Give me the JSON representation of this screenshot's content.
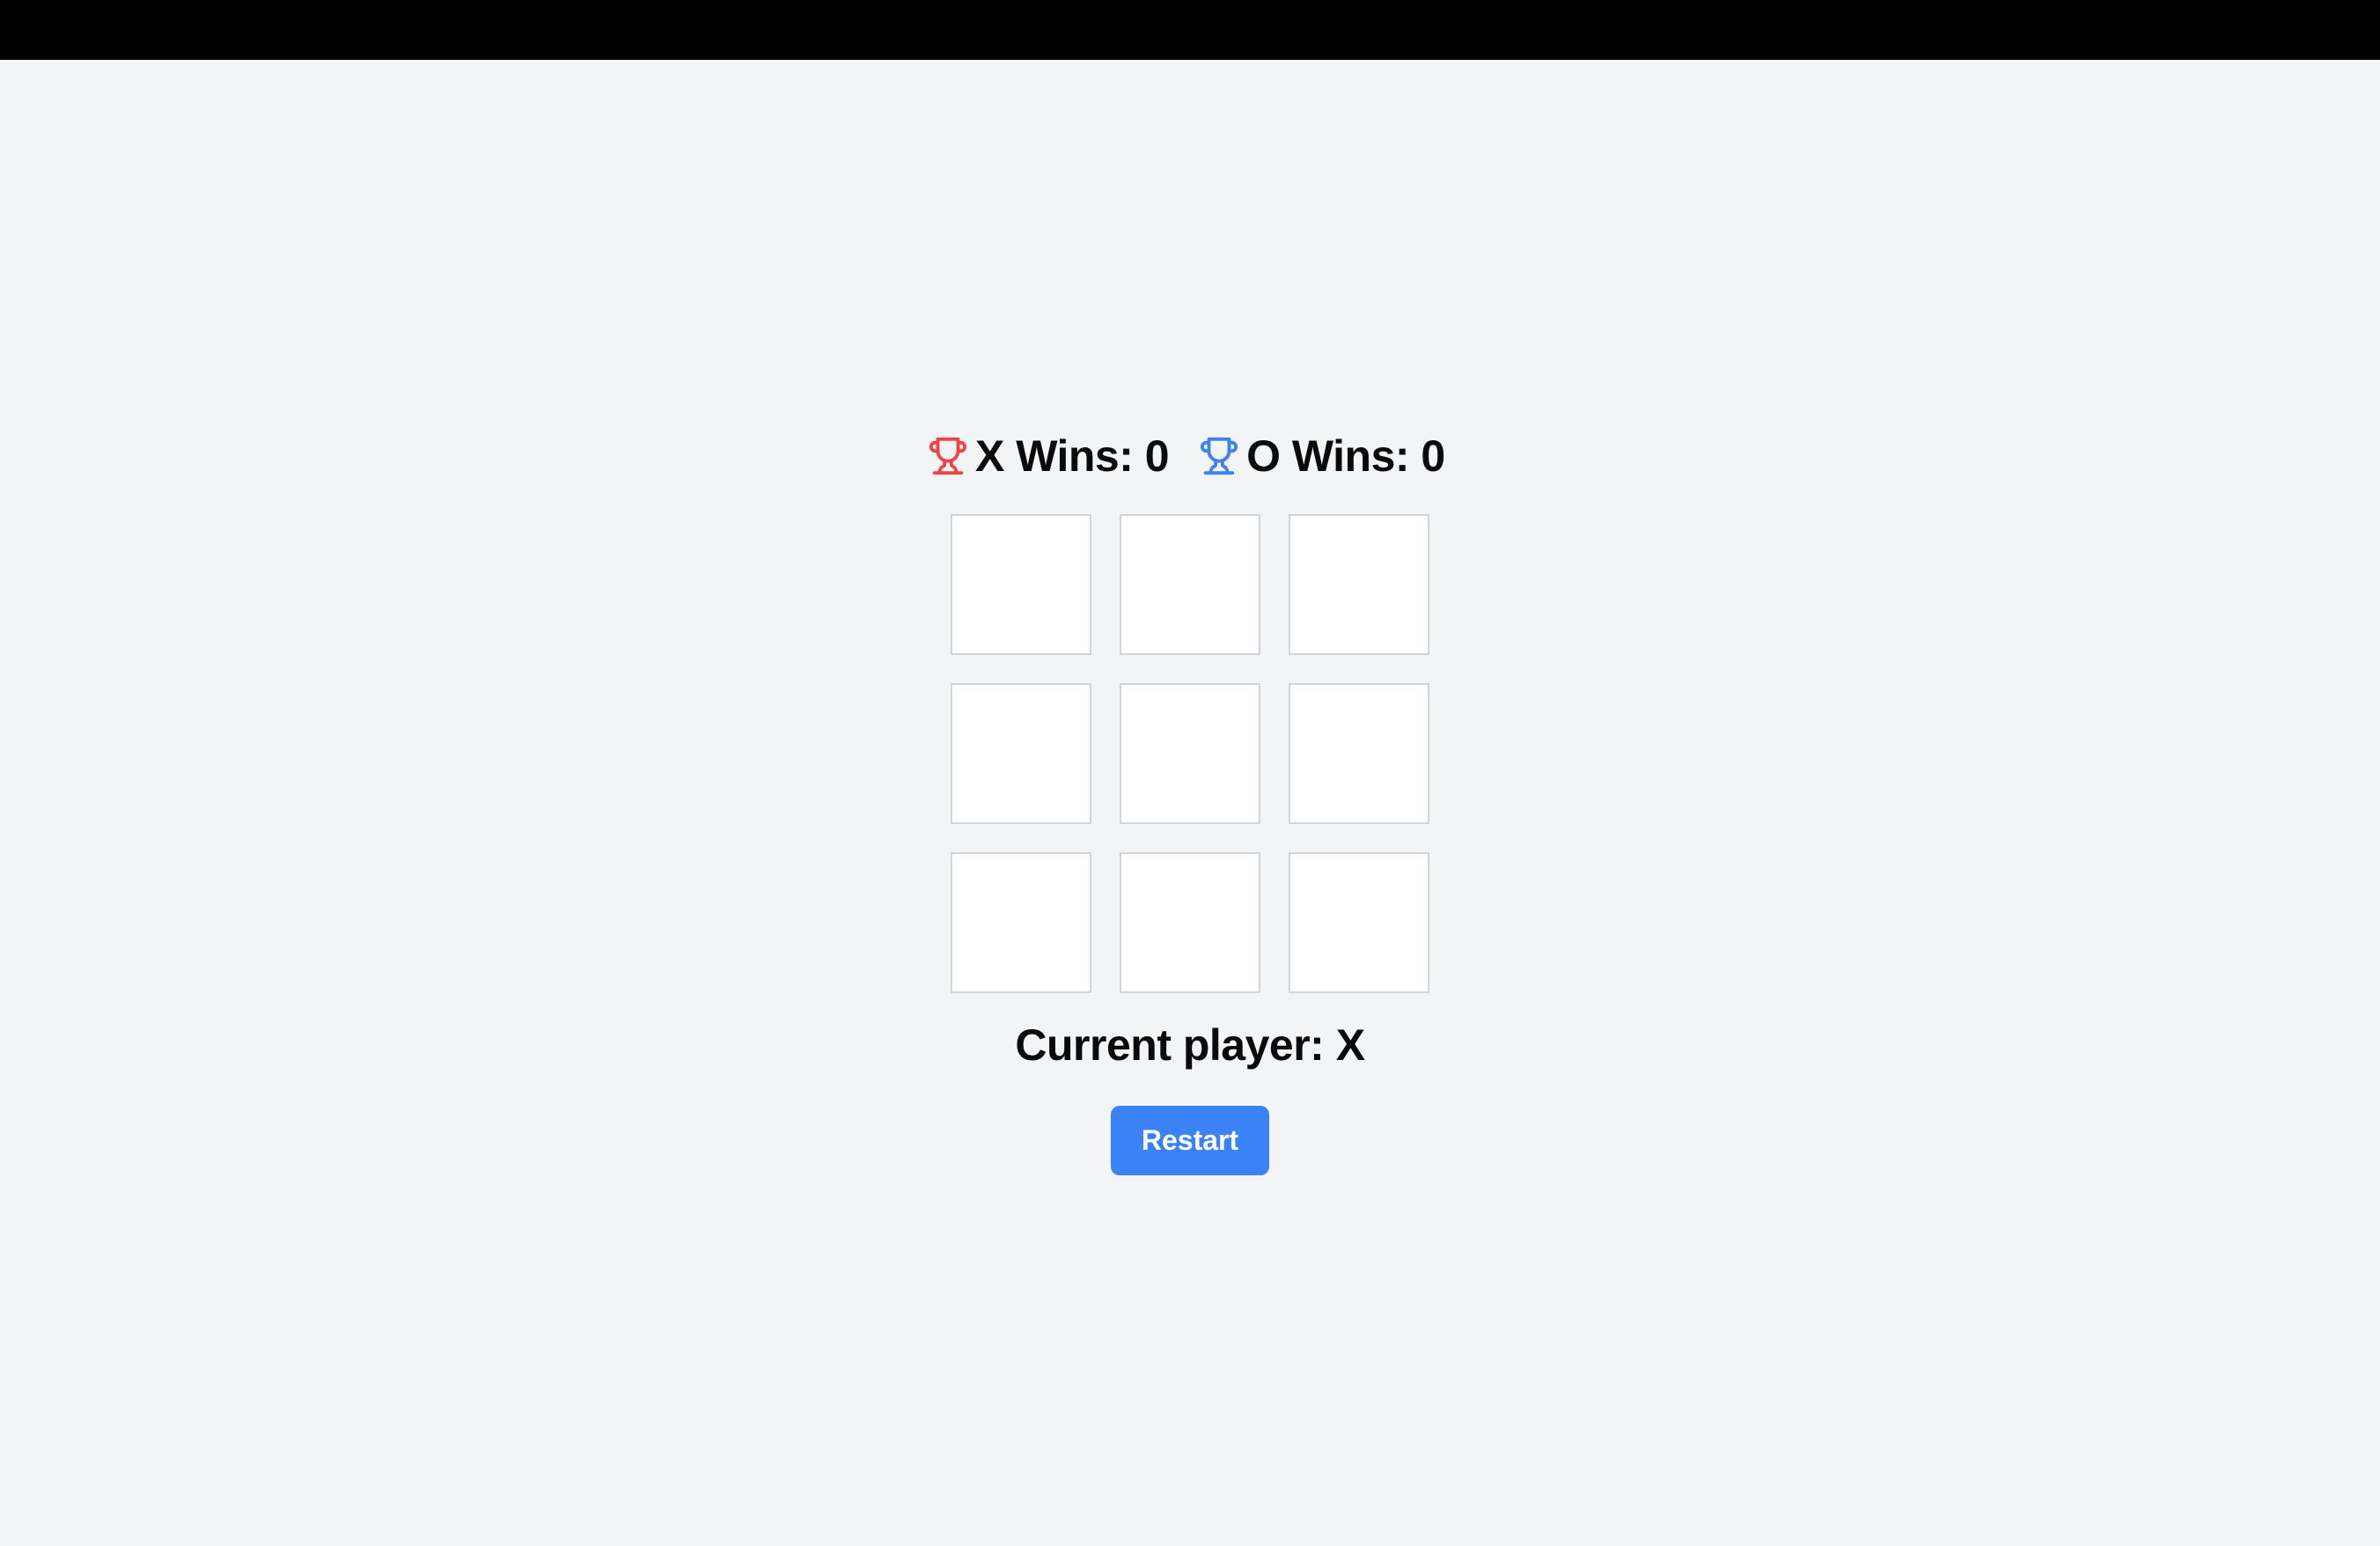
{
  "scoreboard": {
    "x": {
      "label": "X Wins: 0",
      "icon": "trophy-icon",
      "color": "#ef4444"
    },
    "o": {
      "label": "O Wins: 0",
      "icon": "trophy-icon",
      "color": "#3b82f6"
    }
  },
  "board": {
    "cells": [
      "",
      "",
      "",
      "",
      "",
      "",
      "",
      "",
      ""
    ]
  },
  "status": {
    "text": "Current player: X"
  },
  "restart": {
    "label": "Restart",
    "color": "#3b82f6"
  },
  "colors": {
    "background": "#f3f4f6",
    "cell_border": "#d1d5db"
  }
}
